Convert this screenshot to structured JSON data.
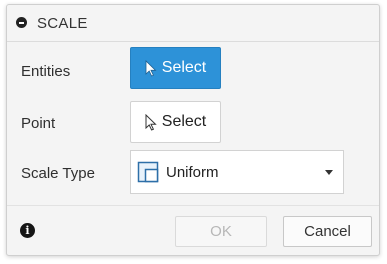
{
  "dialog": {
    "title": "SCALE",
    "rows": {
      "entities": {
        "label": "Entities",
        "button_label": "Select",
        "active": true
      },
      "point": {
        "label": "Point",
        "button_label": "Select",
        "active": false
      },
      "scale_type": {
        "label": "Scale Type",
        "selected": "Uniform"
      }
    },
    "footer": {
      "ok_label": "OK",
      "cancel_label": "Cancel",
      "ok_enabled": false
    }
  },
  "colors": {
    "accent": "#2d92d8",
    "background": "#f4f4f4"
  },
  "icons": [
    "collapse-icon",
    "cursor-arrow-icon",
    "uniform-scale-icon",
    "chevron-down-icon",
    "info-icon"
  ]
}
